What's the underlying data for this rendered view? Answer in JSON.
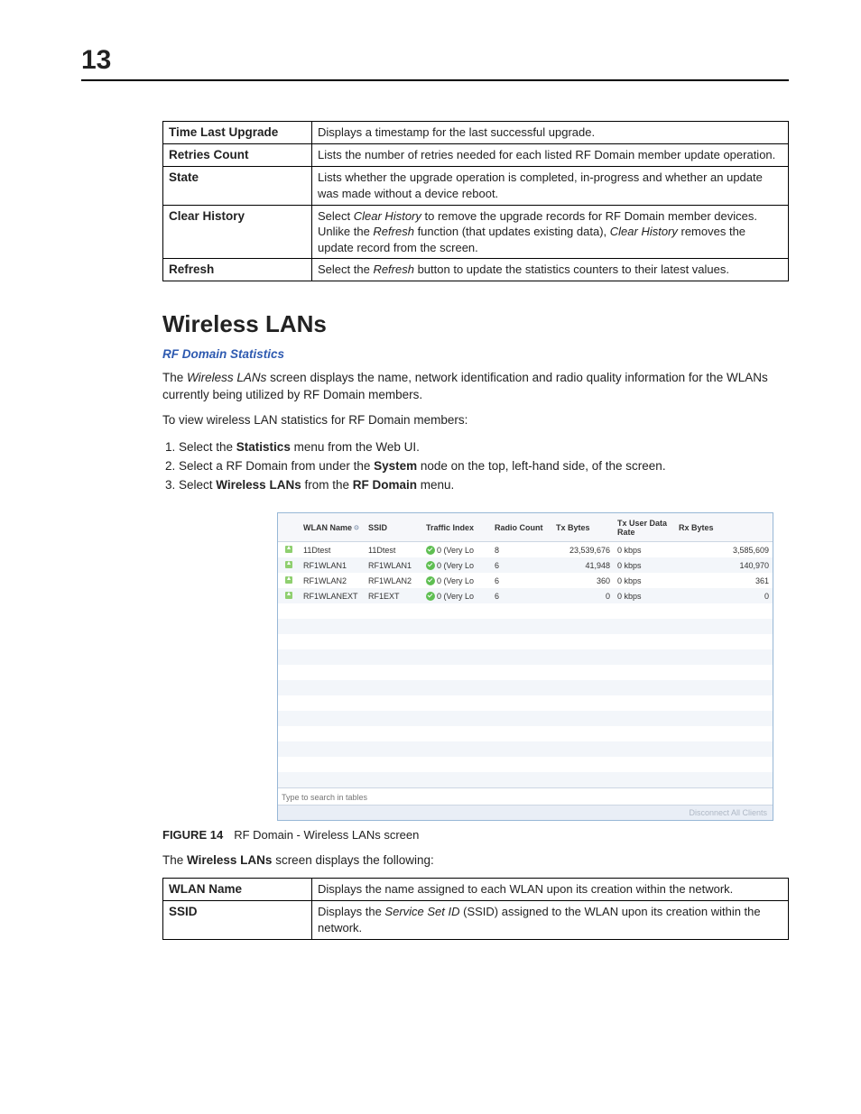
{
  "page_number": "13",
  "table1": [
    {
      "label": "Time Last Upgrade",
      "desc_plain": "Displays a timestamp for the last successful upgrade.",
      "desc_html": "Displays a timestamp for the last successful upgrade."
    },
    {
      "label": "Retries Count",
      "desc_plain": "Lists the number of retries needed for each listed RF Domain member update operation.",
      "desc_html": "Lists the number of retries needed for each listed RF Domain member update operation."
    },
    {
      "label": "State",
      "desc_plain": "Lists whether the upgrade operation is completed, in-progress and whether an update was made without a device reboot.",
      "desc_html": "Lists whether the upgrade operation is completed, in-progress and whether an update was made without a device reboot."
    },
    {
      "label": "Clear History",
      "desc_plain": "Select Clear History to remove the upgrade records for RF Domain member devices. Unlike the Refresh function (that updates existing data), Clear History removes the update record from the screen.",
      "desc_html": "Select <i>Clear History</i> to remove the upgrade records for RF Domain member devices. Unlike the <i>Refresh</i> function (that updates existing data), <i>Clear History</i> removes the update record from the screen."
    },
    {
      "label": "Refresh",
      "desc_plain": "Select the Refresh button to update the statistics counters to their latest values.",
      "desc_html": "Select the <i>Refresh</i> button to update the statistics counters to their latest values."
    }
  ],
  "section_title": "Wireless LANs",
  "breadcrumb": "RF Domain Statistics",
  "para1_html": "The <i>Wireless LANs</i> screen displays the name, network identification and radio quality information for the WLANs currently being utilized by RF Domain members.",
  "para2": "To view wireless LAN statistics for RF Domain members:",
  "steps": [
    "Select the <b>Statistics</b> menu from the Web UI.",
    "Select a RF Domain from under the <b>System</b> node on the top, left-hand side, of the screen.",
    "Select <b>Wireless LANs</b> from the <b>RF Domain</b> menu."
  ],
  "screenshot": {
    "headers": {
      "name": "WLAN Name",
      "ssid": "SSID",
      "traffic": "Traffic Index",
      "radio": "Radio Count",
      "txb": "Tx Bytes",
      "txu": "Tx User Data Rate",
      "rxb": "Rx Bytes"
    },
    "rows": [
      {
        "name": "11Dtest",
        "ssid": "11Dtest",
        "traffic": "0 (Very Lo",
        "radio": "8",
        "txb": "23,539,676",
        "txu": "0 kbps",
        "rxb": "3,585,609"
      },
      {
        "name": "RF1WLAN1",
        "ssid": "RF1WLAN1",
        "traffic": "0 (Very Lo",
        "radio": "6",
        "txb": "41,948",
        "txu": "0 kbps",
        "rxb": "140,970"
      },
      {
        "name": "RF1WLAN2",
        "ssid": "RF1WLAN2",
        "traffic": "0 (Very Lo",
        "radio": "6",
        "txb": "360",
        "txu": "0 kbps",
        "rxb": "361"
      },
      {
        "name": "RF1WLANEXT",
        "ssid": "RF1EXT",
        "traffic": "0 (Very Lo",
        "radio": "6",
        "txb": "0",
        "txu": "0 kbps",
        "rxb": "0"
      }
    ],
    "empty_rows": 12,
    "search_placeholder": "Type to search in tables",
    "footer_button": "Disconnect All Clients"
  },
  "figure": {
    "label": "FIGURE 14",
    "caption": "RF Domain - Wireless LANs screen"
  },
  "para3_html": "The <b>Wireless LANs</b> screen displays the following:",
  "table2": [
    {
      "label": "WLAN Name",
      "desc_html": "Displays the name assigned to each WLAN upon its creation within the network."
    },
    {
      "label": "SSID",
      "desc_html": "Displays the <i>Service Set ID</i> (SSID) assigned to the WLAN upon its creation within the  network."
    }
  ]
}
